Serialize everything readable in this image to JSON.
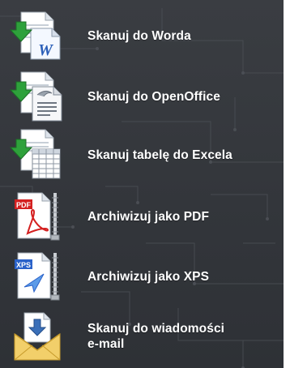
{
  "menu": {
    "items": [
      {
        "label": "Skanuj do Worda",
        "icon": "word-document-icon"
      },
      {
        "label": "Skanuj do OpenOffice",
        "icon": "openoffice-document-icon"
      },
      {
        "label": "Skanuj tabelę do Excela",
        "icon": "excel-spreadsheet-icon"
      },
      {
        "label": "Archiwizuj jako PDF",
        "icon": "pdf-archive-icon"
      },
      {
        "label": "Archiwizuj jako XPS",
        "icon": "xps-archive-icon"
      },
      {
        "label_line1": "Skanuj do wiadomości",
        "label_line2": "e-mail",
        "icon": "email-envelope-icon"
      }
    ]
  },
  "icon_badges": {
    "pdf": "PDF",
    "xps": "XPS",
    "word": "W"
  },
  "colors": {
    "panel_background": "#36393e",
    "label_text": "#ffffff",
    "scan_arrow": "#2ea13b",
    "pdf_red": "#d42020",
    "xps_blue": "#2a62c9",
    "envelope": "#f2cf6a"
  }
}
